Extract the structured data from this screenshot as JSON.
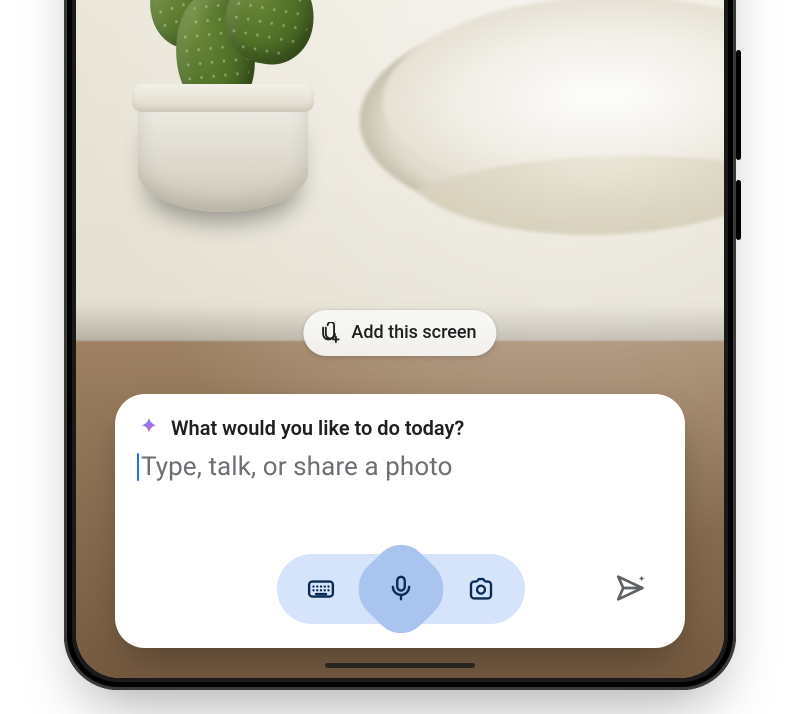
{
  "chip": {
    "label": "Add this screen",
    "icon": "attach-add-icon"
  },
  "assistant": {
    "sparkle_icon": "gemini-sparkle-icon",
    "prompt_title": "What would you like to do today?",
    "input_value": "",
    "input_placeholder": "Type, talk, or share a photo"
  },
  "toolbar": {
    "keyboard_icon": "keyboard-icon",
    "microphone_icon": "microphone-icon",
    "camera_icon": "camera-icon",
    "send_icon": "send-sparkle-icon"
  },
  "colors": {
    "accent_blue": "#1a73e8",
    "pill_bg": "#d6e4fb",
    "mic_blob": "#a9c4ef",
    "text_primary": "#1f1f1f",
    "text_secondary": "#6c6f73"
  }
}
